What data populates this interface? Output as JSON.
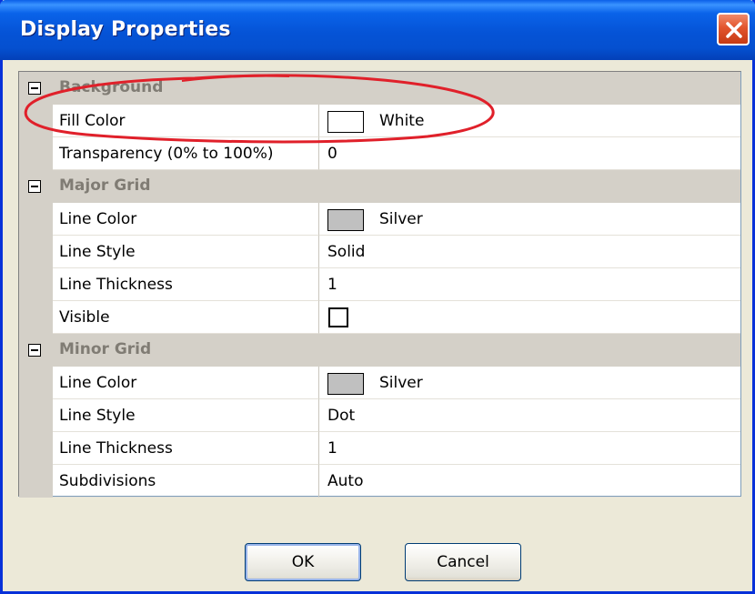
{
  "window": {
    "title": "Display Properties",
    "close_icon": "close-icon"
  },
  "property_grid": {
    "categories": [
      {
        "label": "Background",
        "properties": [
          {
            "name": "Fill Color",
            "value": "White",
            "swatch": "#ffffff"
          },
          {
            "name": "Transparency (0% to 100%)",
            "value": "0"
          }
        ]
      },
      {
        "label": "Major Grid",
        "properties": [
          {
            "name": "Line Color",
            "value": "Silver",
            "swatch": "#c0c0c0"
          },
          {
            "name": "Line Style",
            "value": "Solid"
          },
          {
            "name": "Line Thickness",
            "value": "1"
          },
          {
            "name": "Visible",
            "checked": false
          }
        ]
      },
      {
        "label": "Minor Grid",
        "properties": [
          {
            "name": "Line Color",
            "value": "Silver",
            "swatch": "#c0c0c0"
          },
          {
            "name": "Line Style",
            "value": "Dot"
          },
          {
            "name": "Line Thickness",
            "value": "1"
          },
          {
            "name": "Subdivisions",
            "value": "Auto"
          }
        ]
      }
    ]
  },
  "buttons": {
    "ok_label": "OK",
    "cancel_label": "Cancel"
  },
  "colors": {
    "titlebar": "#0553d6",
    "window_bg": "#ece9d8",
    "annotation": "#e0202a"
  }
}
